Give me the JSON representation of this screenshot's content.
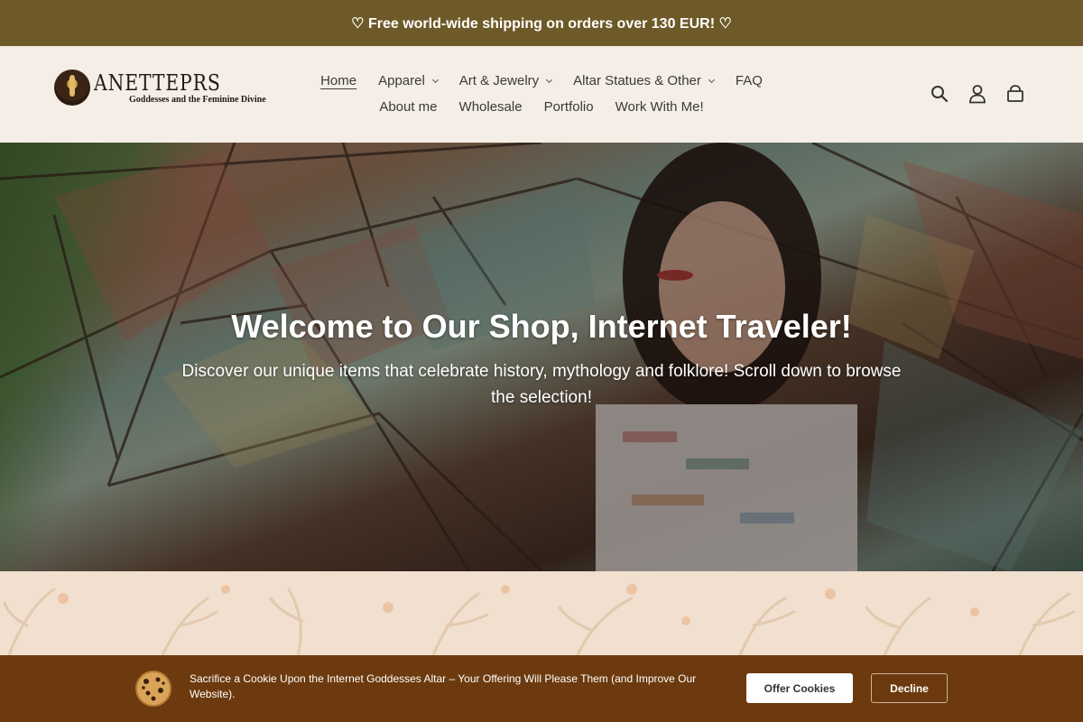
{
  "announcement": {
    "text": "♡ Free world-wide shipping on orders over 130 EUR! ♡"
  },
  "logo": {
    "title": "ANETTEPRS",
    "subtitle": "Goddesses and the Feminine Divine"
  },
  "nav": {
    "row1": [
      {
        "label": "Home",
        "active": true,
        "dropdown": false
      },
      {
        "label": "Apparel",
        "dropdown": true
      },
      {
        "label": "Art & Jewelry",
        "dropdown": true
      },
      {
        "label": "Altar Statues & Other",
        "dropdown": true
      },
      {
        "label": "FAQ",
        "dropdown": false
      }
    ],
    "row2": [
      {
        "label": "About me"
      },
      {
        "label": "Wholesale"
      },
      {
        "label": "Portfolio"
      },
      {
        "label": "Work With Me!"
      }
    ]
  },
  "header_icons": [
    "search-icon",
    "account-icon",
    "cart-icon"
  ],
  "hero": {
    "title": "Welcome to Our Shop, Internet Traveler!",
    "subtitle": "Discover our unique items that celebrate history, mythology and folklore! Scroll down to browse the selection!"
  },
  "cookie_banner": {
    "text": "Sacrifice a Cookie Upon the Internet Goddesses Altar – Your Offering Will Please Them (and Improve Our Website).",
    "accept_label": "Offer Cookies",
    "decline_label": "Decline"
  },
  "colors": {
    "announcement_bg": "#6e5a28",
    "header_bg": "#f4eee6",
    "cookie_bg": "#6c3a0e",
    "pattern_bg": "#f1e0cf"
  }
}
